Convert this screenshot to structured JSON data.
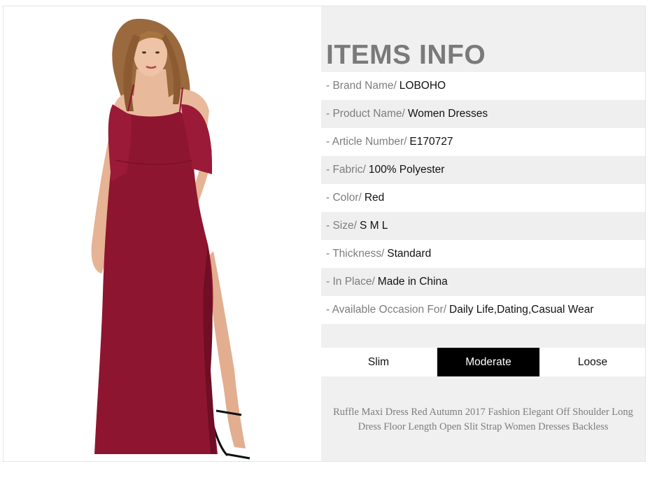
{
  "header": {
    "title": "ITEMS INFO"
  },
  "specs": [
    {
      "label": "- Brand Name/",
      "value": "LOBOHO"
    },
    {
      "label": "- Product Name/",
      "value": "Women Dresses"
    },
    {
      "label": "- Article Number/",
      "value": "E170727"
    },
    {
      "label": "- Fabric/",
      "value": "100% Polyester"
    },
    {
      "label": "- Color/",
      "value": "Red"
    },
    {
      "label": "- Size/",
      "value": "S M L"
    },
    {
      "label": "- Thickness/",
      "value": "Standard"
    },
    {
      "label": "- In Place/",
      "value": "Made in China"
    },
    {
      "label": "- Available Occasion For/",
      "value": "Daily Life,Dating,Casual Wear"
    }
  ],
  "fit": {
    "options": [
      "Slim",
      "Moderate",
      "Loose"
    ],
    "selected": "Moderate"
  },
  "description": {
    "line1": "Ruffle Maxi Dress Red Autumn 2017 Fashion Elegant Off Shoulder Long",
    "line2": "Dress Floor Length Open Slit Strap Women Dresses Backless"
  },
  "colors": {
    "dress": "#8e1530",
    "title": "#7a7a7a",
    "selected_fit_bg": "#000000"
  }
}
